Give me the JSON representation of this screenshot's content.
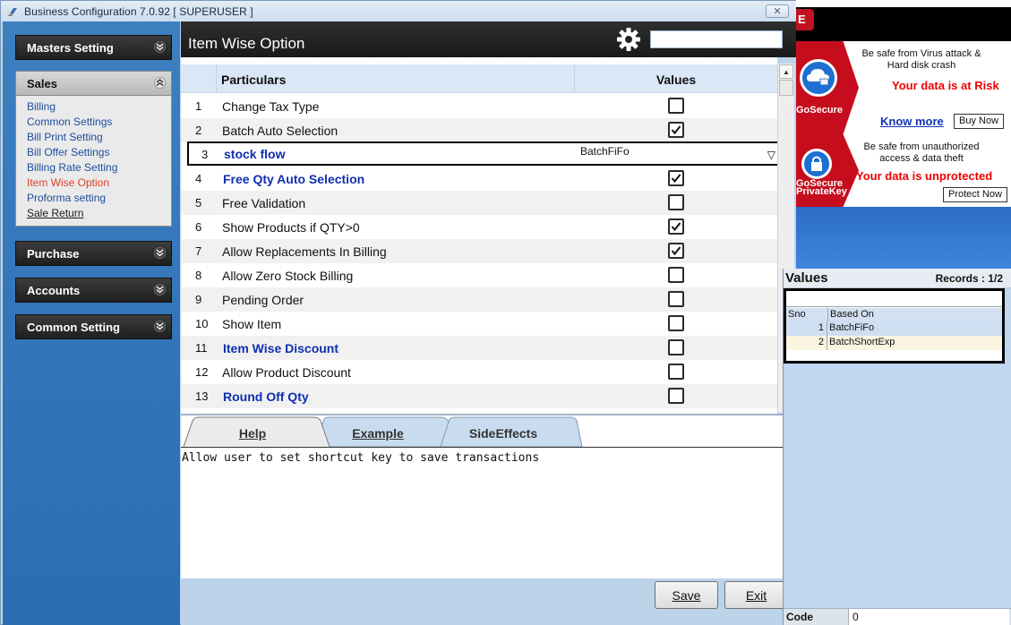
{
  "window": {
    "title": "Business Configuration 7.0.92 [ SUPERUSER ]",
    "close_label": "✕"
  },
  "nav": {
    "sections": [
      "Masters Setting",
      "Sales",
      "Purchase",
      "Accounts",
      "Common Setting"
    ],
    "sales_items": [
      "Billing",
      "Common Settings",
      "Bill Print Setting",
      "Bill Offer Settings",
      "Billing Rate Setting",
      "Item Wise Option",
      "Proforma setting",
      "Sale Return"
    ],
    "active_item": "Item Wise Option"
  },
  "page": {
    "title": "Item Wise Option",
    "search_value": ""
  },
  "grid": {
    "col_particulars": "Particulars",
    "col_values": "Values",
    "rows": [
      {
        "no": "1",
        "label": "Change Tax Type",
        "checked": false,
        "bold": false
      },
      {
        "no": "2",
        "label": "Batch Auto Selection",
        "checked": true,
        "bold": false
      },
      {
        "no": "3",
        "label": "stock flow",
        "bold": true,
        "dropdown": "BatchFiFo"
      },
      {
        "no": "4",
        "label": "Free Qty Auto Selection",
        "checked": true,
        "bold": true
      },
      {
        "no": "5",
        "label": "Free Validation",
        "checked": false,
        "bold": false
      },
      {
        "no": "6",
        "label": "Show Products if QTY>0",
        "checked": true,
        "bold": false
      },
      {
        "no": "7",
        "label": "Allow Replacements In Billing",
        "checked": true,
        "bold": false
      },
      {
        "no": "8",
        "label": "Allow Zero Stock Billing",
        "checked": false,
        "bold": false
      },
      {
        "no": "9",
        "label": "Pending Order",
        "checked": false,
        "bold": false
      },
      {
        "no": "10",
        "label": "Show Item",
        "checked": false,
        "bold": false
      },
      {
        "no": "11",
        "label": "Item Wise Discount",
        "checked": false,
        "bold": true
      },
      {
        "no": "12",
        "label": "Allow Product Discount",
        "checked": false,
        "bold": false
      },
      {
        "no": "13",
        "label": "Round Off Qty",
        "checked": false,
        "bold": true
      }
    ],
    "dropdown_arrow": "▽"
  },
  "tabs": {
    "help": "Help",
    "example": "Example",
    "sideeffects": "SideEffects"
  },
  "help_text": "Allow user to set shortcut key to save transactions",
  "buttons": {
    "save": "Save",
    "exit": "Exit"
  },
  "ads": {
    "close_mark": "E",
    "ad1": {
      "line1": "Be safe from Virus attack &",
      "line2": "Hard disk crash",
      "headline": "Your data is at Risk",
      "link": "Know more",
      "button": "Buy Now",
      "brand": "GoSecure"
    },
    "ad2": {
      "line1": "Be safe from unauthorized",
      "line2": "access & data theft",
      "headline": "Your data is unprotected",
      "button": "Protect Now",
      "brand1": "GoSecure",
      "brand2": "PrivateKey"
    }
  },
  "values_panel": {
    "title": "Values",
    "records": "Records : 1/2",
    "col_sno": "Sno",
    "col_based_on": "Based On",
    "rows": [
      {
        "sno": "1",
        "based_on": "BatchFiFo"
      },
      {
        "sno": "2",
        "based_on": "BatchShortExp"
      }
    ],
    "code_label": "Code",
    "code_value": "0"
  },
  "colors": {
    "accent_blue": "#0f2fb0",
    "active_link": "#e0402b",
    "nav_bg": "#2a6db1",
    "header_bg": "#1a1a1a"
  }
}
